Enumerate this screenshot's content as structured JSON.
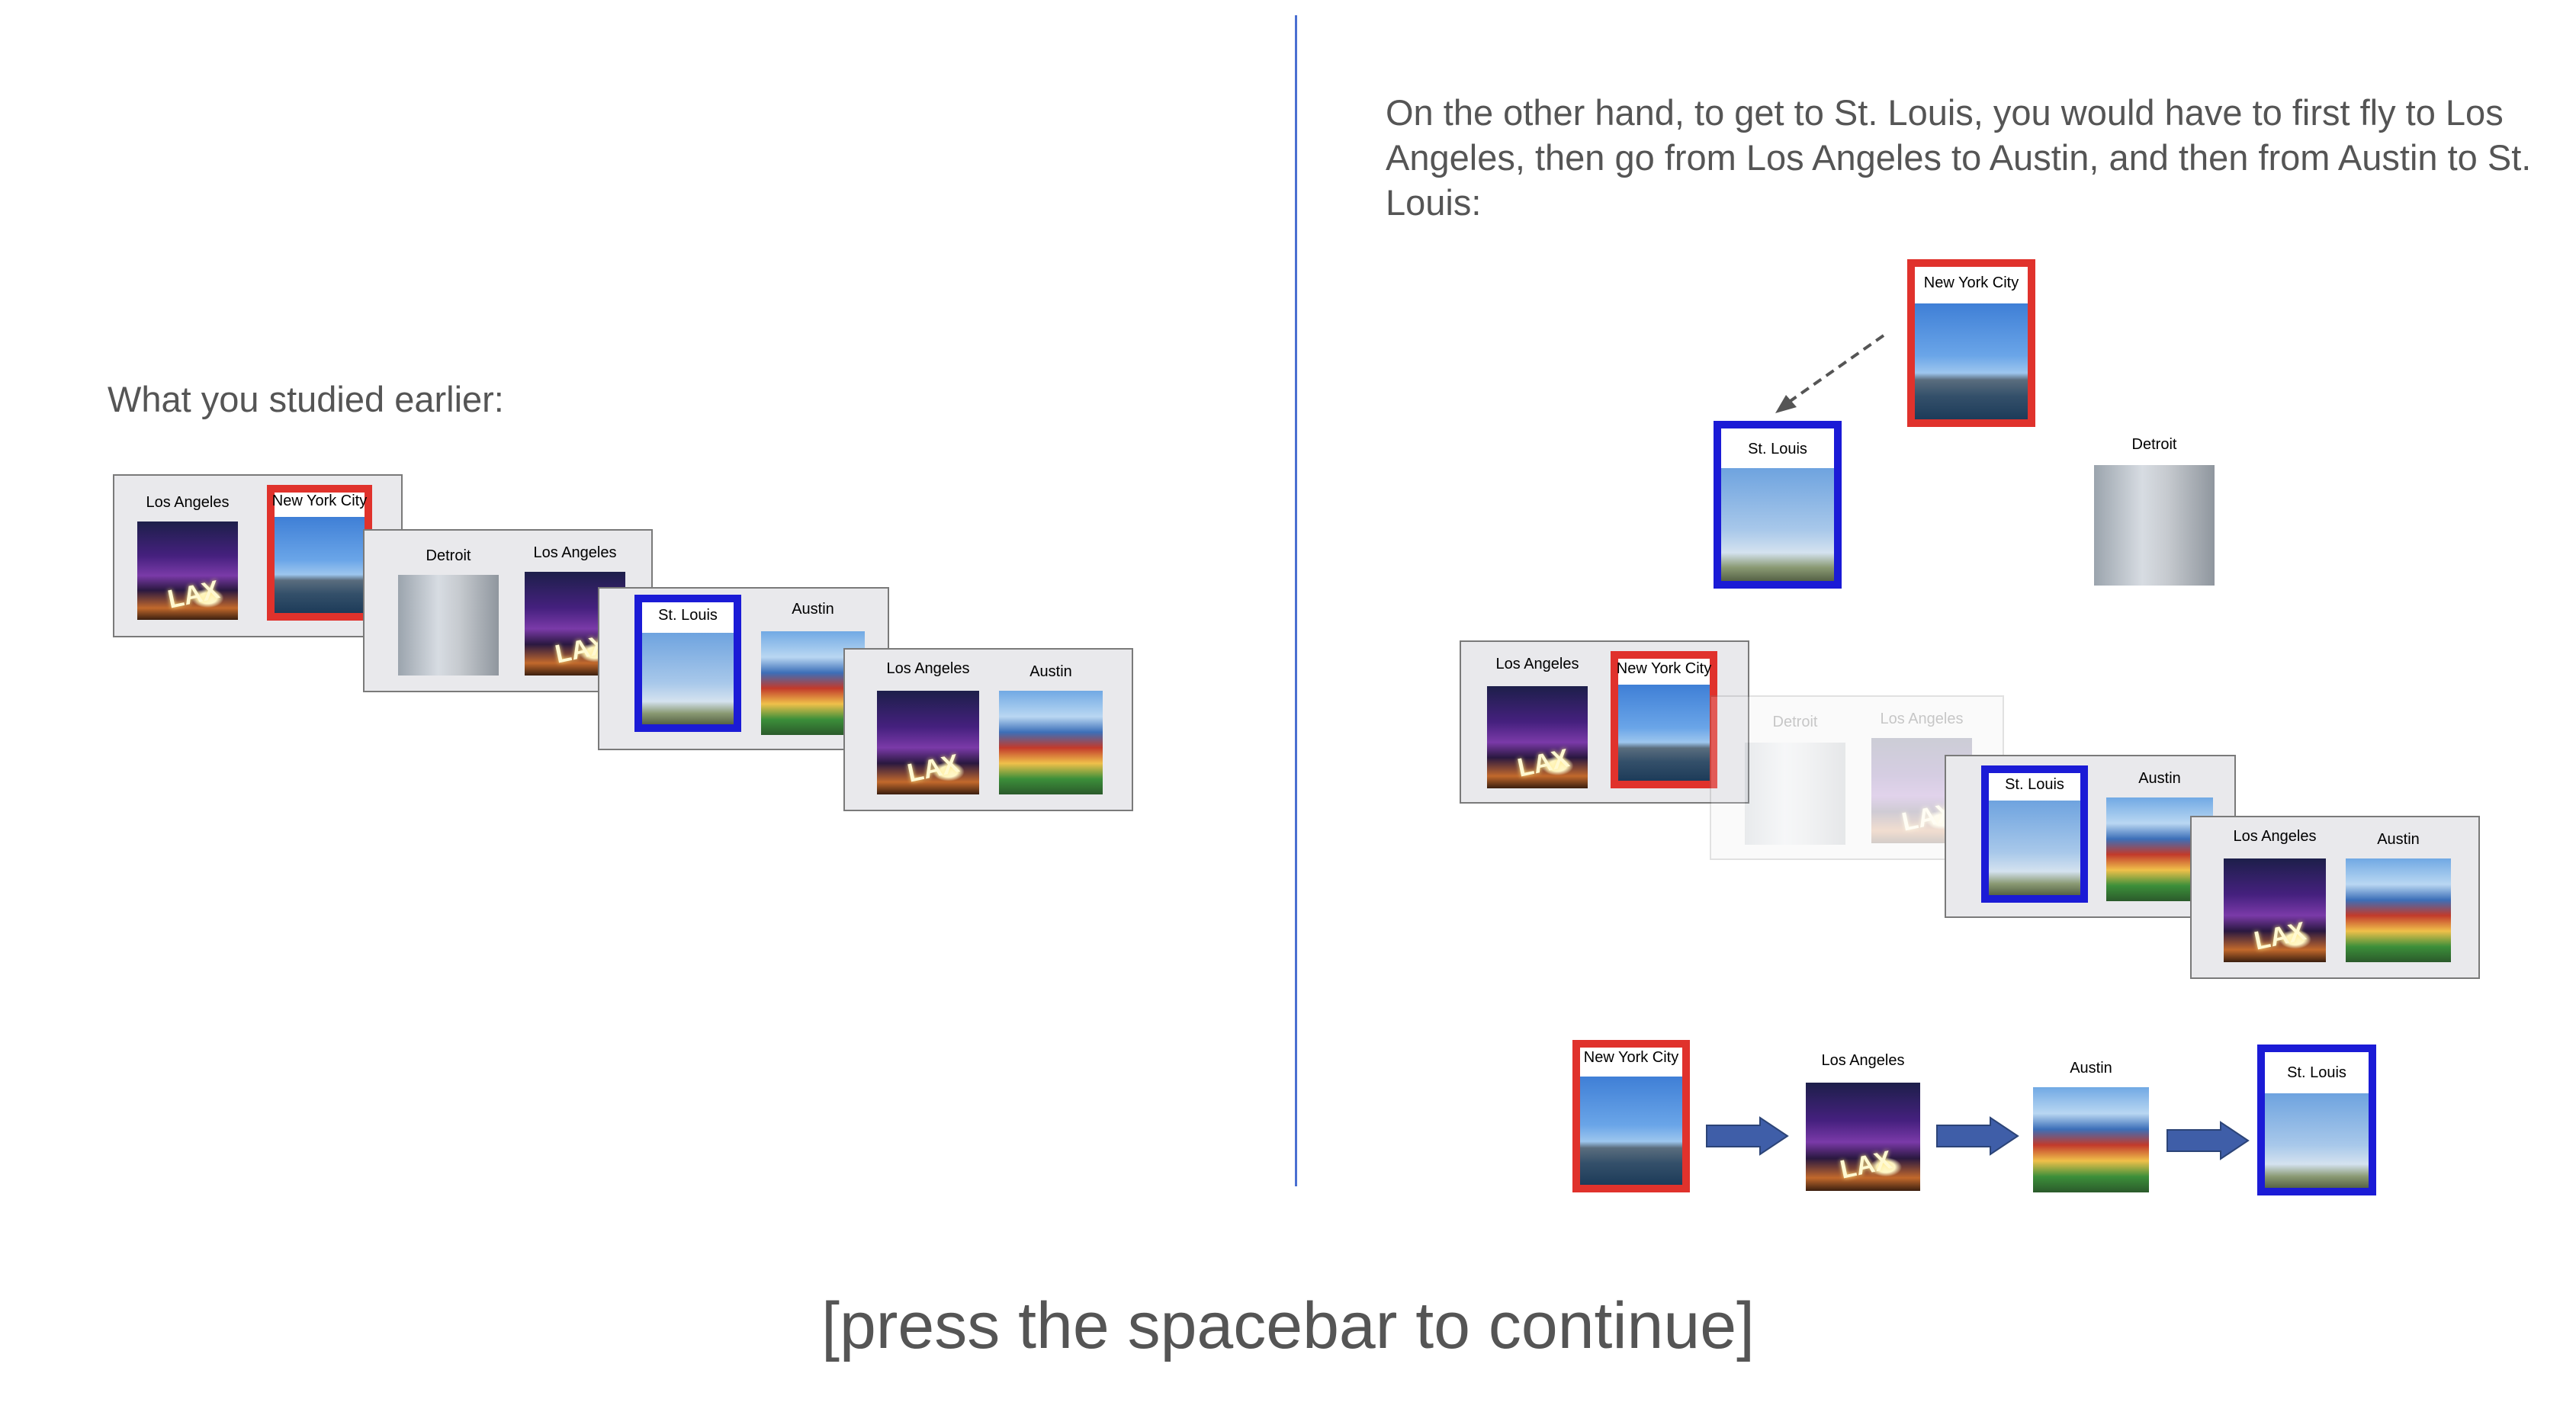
{
  "left": {
    "heading": "What you studied earlier:",
    "panels": [
      {
        "a": "Los Angeles",
        "b": "New York City"
      },
      {
        "a": "Detroit",
        "b": "Los Angeles"
      },
      {
        "a": "St. Louis",
        "b": "Austin"
      },
      {
        "a": "Los Angeles",
        "b": "Austin"
      }
    ]
  },
  "right": {
    "heading": "On the other hand, to get to St. Louis, you would have to first fly to Los Angeles, then go from Los Angeles to Austin, and then from Austin to St. Louis:",
    "top_cards": {
      "start": "New York City",
      "target": "St. Louis",
      "other": "Detroit"
    },
    "panels": [
      {
        "a": "Los Angeles",
        "b": "New York City"
      },
      {
        "a": "Detroit",
        "b": "Los Angeles"
      },
      {
        "a": "St. Louis",
        "b": "Austin"
      },
      {
        "a": "Los Angeles",
        "b": "Austin"
      }
    ],
    "route": [
      "New York City",
      "Los Angeles",
      "Austin",
      "St. Louis"
    ]
  },
  "footer": {
    "continue_text": "[press the spacebar to continue]"
  },
  "colors": {
    "start_border": "#e0322c",
    "target_border": "#1b1bd6",
    "divider": "#4a6fd1",
    "arrow": "#3f5ea8"
  },
  "icons": [
    "right-arrow-icon",
    "dashed-arrow-icon"
  ]
}
